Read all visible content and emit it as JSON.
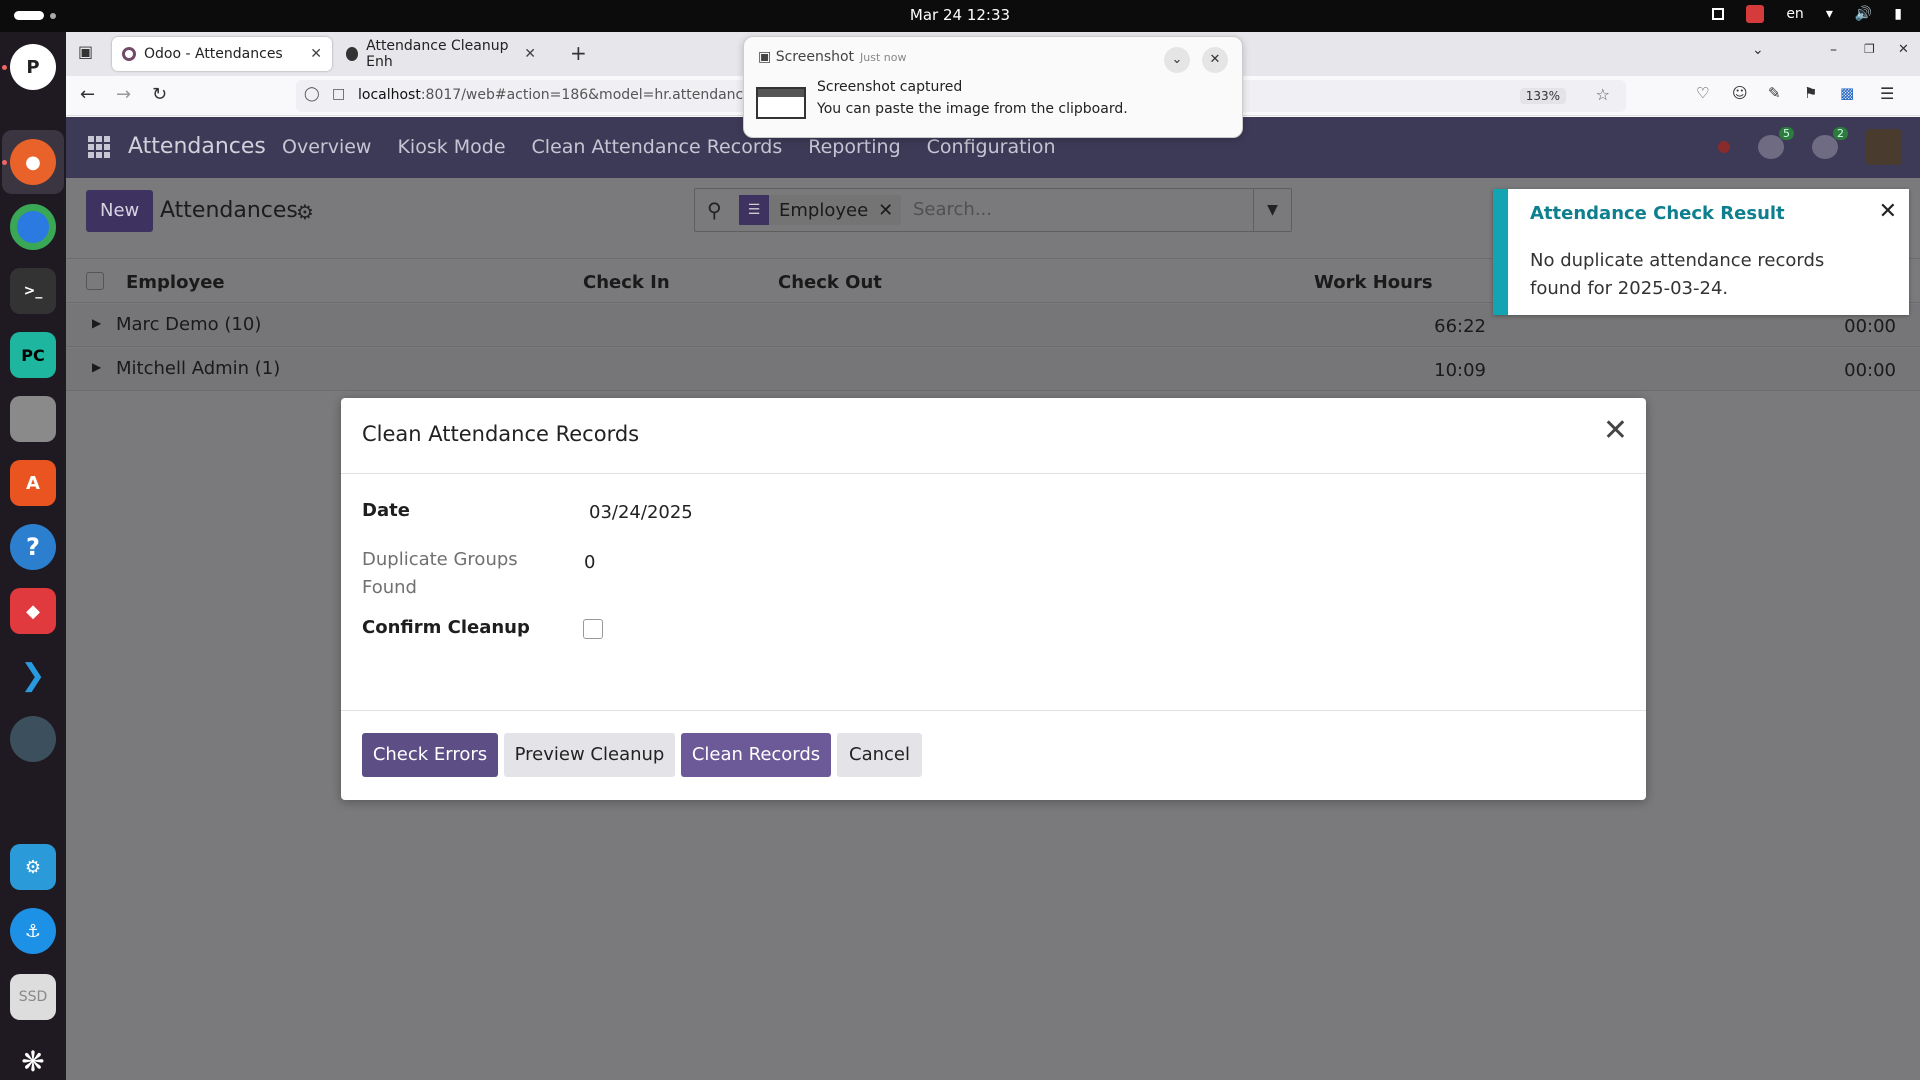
{
  "system": {
    "clock": "Mar 24  12:33",
    "lang": "en"
  },
  "dock": {
    "items": [
      "pocketcasts-icon",
      "firefox-icon",
      "chrome-icon",
      "terminal-icon",
      "pycharm-icon",
      "files-icon",
      "appcenter-icon",
      "help-icon",
      "anydesk-icon",
      "vscode-icon",
      "disk-usage-icon",
      "settings-icon",
      "docker-icon",
      "ssd-drive-icon",
      "ubuntu-icon"
    ],
    "ssd_label": "SSD"
  },
  "browser": {
    "tabs": [
      {
        "title": "Odoo - Attendances"
      },
      {
        "title": "Attendance Cleanup Enh"
      }
    ],
    "url_host": "localhost",
    "url_rest": ":8017/web#action=186&model=hr.attendance",
    "zoom": "133%"
  },
  "screenshot_notice": {
    "app": "Screenshot",
    "time": "Just now",
    "title": "Screenshot captured",
    "body": "You can paste the image from the clipboard."
  },
  "odoo": {
    "brand": "Attendances",
    "menu": [
      "Overview",
      "Kiosk Mode",
      "Clean Attendance Records",
      "Reporting",
      "Configuration"
    ],
    "chat_count": "5",
    "activity_count": "2",
    "new_label": "New",
    "page_title": "Attendances",
    "facet_label": "Employee",
    "search_placeholder": "Search...",
    "columns": {
      "employee": "Employee",
      "check_in": "Check In",
      "check_out": "Check Out",
      "work_hours": "Work Hours"
    },
    "groups": [
      {
        "name": "Marc Demo (10)",
        "work_hours": "66:22",
        "other": "00:00"
      },
      {
        "name": "Mitchell Admin (1)",
        "work_hours": "10:09",
        "other": "00:00"
      }
    ]
  },
  "toast": {
    "title": "Attendance Check Result",
    "body": "No duplicate attendance records found for 2025-03-24."
  },
  "modal": {
    "title": "Clean Attendance Records",
    "date_label": "Date",
    "date_value": "03/24/2025",
    "dup_label": "Duplicate Groups Found",
    "dup_value": "0",
    "confirm_label": "Confirm Cleanup",
    "confirm_checked": false,
    "buttons": {
      "check_errors": "Check Errors",
      "preview": "Preview Cleanup",
      "clean": "Clean Records",
      "cancel": "Cancel"
    }
  }
}
